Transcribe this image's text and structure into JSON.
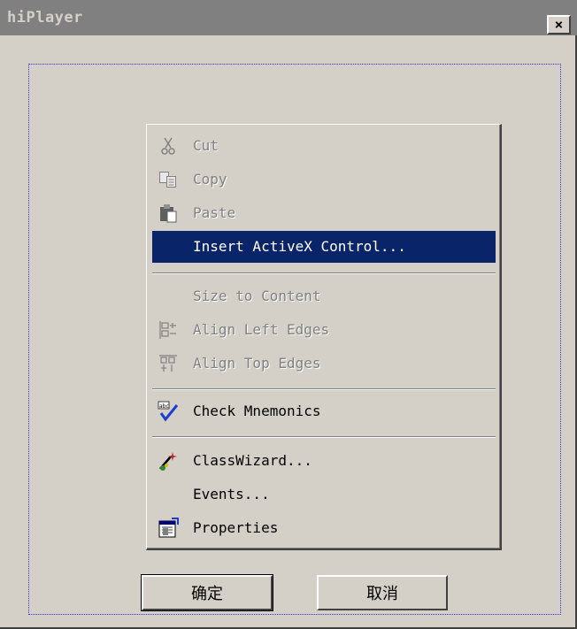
{
  "window": {
    "title": "hiPlayer",
    "close_glyph": "×"
  },
  "menu": {
    "items": [
      {
        "label": "Cut",
        "icon": "scissors-icon"
      },
      {
        "label": "Copy",
        "icon": "copy-icon"
      },
      {
        "label": "Paste",
        "icon": "paste-icon"
      },
      {
        "label": "Insert ActiveX Control..."
      },
      {
        "label": "Size to Content"
      },
      {
        "label": "Align Left Edges",
        "icon": "align-left-icon"
      },
      {
        "label": "Align Top Edges",
        "icon": "align-top-icon"
      },
      {
        "label": "Check Mnemonics",
        "icon": "check-mnemonics-icon"
      },
      {
        "label": "ClassWizard...",
        "icon": "wand-icon"
      },
      {
        "label": "Events..."
      },
      {
        "label": "Properties",
        "icon": "properties-icon"
      }
    ]
  },
  "buttons": {
    "ok": "确定",
    "cancel": "取消"
  },
  "colors": {
    "highlight": "#0a246a",
    "face": "#d4d0c8",
    "title_inactive": "#808080"
  }
}
